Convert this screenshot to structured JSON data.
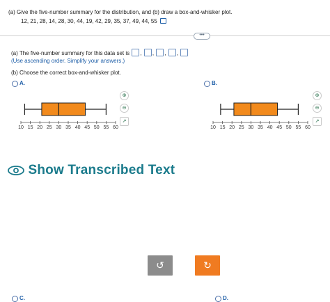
{
  "question": {
    "prompt": "(a) Give the five-number summary for the distribution, and (b) draw a box-and-whisker plot.",
    "data_values": "12, 21, 28, 14, 28, 30, 44, 19, 42, 29, 35, 37, 49, 44, 55"
  },
  "separator_label": "•••",
  "part_a": {
    "label": "(a) The five-number summary for this data set is",
    "separator": ",",
    "blanks": 5,
    "hint": "(Use ascending order. Simplify your answers.)"
  },
  "part_b": {
    "label": "(b) Choose the correct box-and-whisker plot."
  },
  "options": [
    {
      "letter": "A.",
      "min": 12,
      "q1": 21,
      "median": 30,
      "q3": 44,
      "max": 55
    },
    {
      "letter": "B.",
      "min": 14,
      "q1": 21,
      "median": 30,
      "q3": 44,
      "max": 55
    },
    {
      "letter": "C."
    },
    {
      "letter": "D."
    }
  ],
  "axis": {
    "min": 10,
    "max": 60,
    "step": 5,
    "tick_labels": [
      "10",
      "15",
      "20",
      "25",
      "30",
      "35",
      "40",
      "45",
      "50",
      "55",
      "60"
    ]
  },
  "colors": {
    "box_fill": "#f28a1c",
    "accent": "#1b7b8c",
    "button_gray": "#8c8c8c",
    "button_orange": "#f07b21"
  },
  "tools": [
    "zoom-in-icon",
    "zoom-out-icon",
    "open-new-window-icon"
  ],
  "transcribe": {
    "label": "Show Transcribed Text",
    "icon": "eye-icon"
  },
  "buttons": {
    "undo_glyph": "↺",
    "redo_glyph": "↻"
  }
}
